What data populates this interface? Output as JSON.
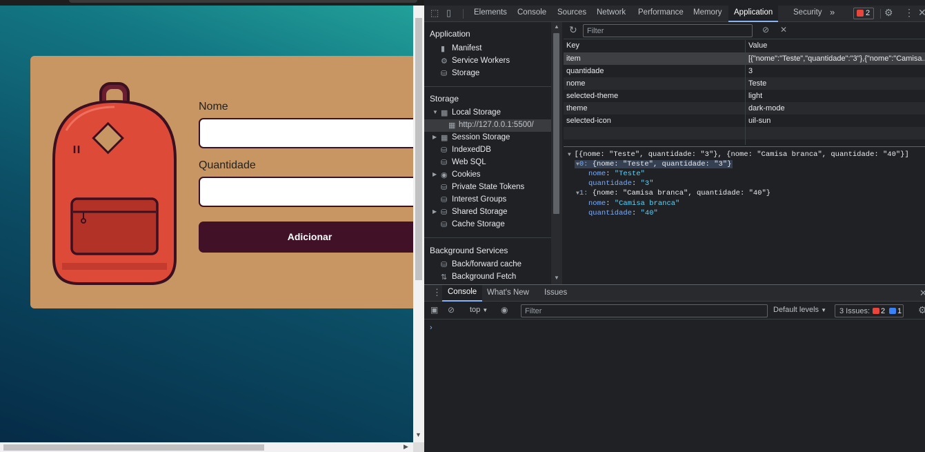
{
  "page": {
    "form": {
      "nome_label": "Nome",
      "quantidade_label": "Quantidade",
      "add_button": "Adicionar"
    }
  },
  "devtools": {
    "tabs": [
      "Elements",
      "Console",
      "Sources",
      "Network",
      "Performance",
      "Memory",
      "Application",
      "Security"
    ],
    "active_tab": "Application",
    "more_tabs": "»",
    "error_count": "2",
    "sidebar": {
      "application_header": "Application",
      "application_items": [
        "Manifest",
        "Service Workers",
        "Storage"
      ],
      "storage_header": "Storage",
      "storage_items": {
        "local_storage": "Local Storage",
        "origin": "http://127.0.0.1:5500/",
        "session_storage": "Session Storage",
        "indexeddb": "IndexedDB",
        "websql": "Web SQL",
        "cookies": "Cookies",
        "private_state_tokens": "Private State Tokens",
        "interest_groups": "Interest Groups",
        "shared_storage": "Shared Storage",
        "cache_storage": "Cache Storage"
      },
      "background_header": "Background Services",
      "background_items": [
        "Back/forward cache",
        "Background Fetch"
      ]
    },
    "storage_toolbar": {
      "filter_placeholder": "Filter"
    },
    "table": {
      "columns": [
        "Key",
        "Value"
      ],
      "rows": [
        {
          "key": "item",
          "value": "[{\"nome\":\"Teste\",\"quantidade\":\"3\"},{\"nome\":\"Camisa..."
        },
        {
          "key": "quantidade",
          "value": "3"
        },
        {
          "key": "nome",
          "value": "Teste"
        },
        {
          "key": "selected-theme",
          "value": "light"
        },
        {
          "key": "theme",
          "value": "dark-mode"
        },
        {
          "key": "selected-icon",
          "value": "uil-sun"
        }
      ]
    },
    "preview": {
      "root_line": "[{nome: \"Teste\", quantidade: \"3\"}, {nome: \"Camisa branca\", quantidade: \"40\"}]",
      "item0_summary": "{nome: \"Teste\", quantidade: \"3\"}",
      "item0_index": "0",
      "item0_nome_key": "nome",
      "item0_nome_val": "\"Teste\"",
      "item0_qtd_key": "quantidade",
      "item0_qtd_val": "\"3\"",
      "item1_summary": "{nome: \"Camisa branca\", quantidade: \"40\"}",
      "item1_index": "1",
      "item1_nome_key": "nome",
      "item1_nome_val": "\"Camisa branca\"",
      "item1_qtd_key": "quantidade",
      "item1_qtd_val": "\"40\""
    },
    "drawer": {
      "tabs": [
        "Console",
        "What's New",
        "Issues"
      ],
      "active_tab": "Console",
      "context": "top",
      "filter_placeholder": "Filter",
      "levels": "Default levels",
      "issues_label": "3 Issues:",
      "issues_errors": "2",
      "issues_info": "1",
      "prompt": "›"
    }
  },
  "colors": {
    "card": "#c79663",
    "button": "#401127",
    "backpack": "#dd4a38",
    "outline": "#3b1020"
  }
}
